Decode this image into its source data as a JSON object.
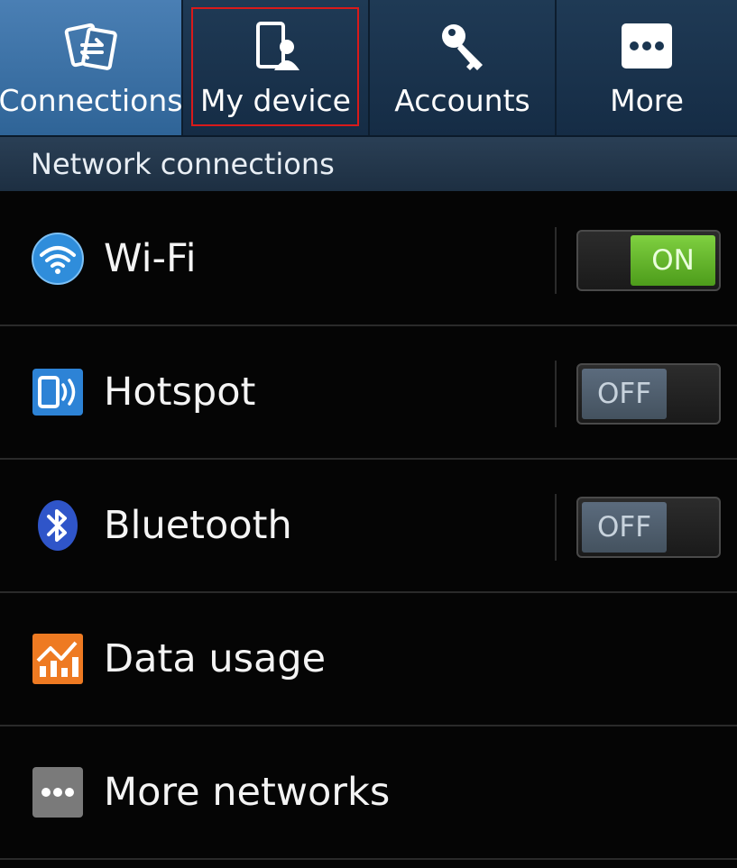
{
  "tabs": [
    {
      "label": "Connections",
      "icon": "connections-icon",
      "selected": true
    },
    {
      "label": "My device",
      "icon": "my-device-icon",
      "selected": false
    },
    {
      "label": "Accounts",
      "icon": "accounts-key-icon",
      "selected": false
    },
    {
      "label": "More",
      "icon": "more-dots-icon",
      "selected": false
    }
  ],
  "section_title": "Network connections",
  "items": [
    {
      "label": "Wi-Fi",
      "icon": "wifi-icon",
      "toggle": "ON"
    },
    {
      "label": "Hotspot",
      "icon": "hotspot-icon",
      "toggle": "OFF"
    },
    {
      "label": "Bluetooth",
      "icon": "bluetooth-icon",
      "toggle": "OFF"
    },
    {
      "label": "Data usage",
      "icon": "data-usage-icon"
    },
    {
      "label": "More networks",
      "icon": "more-networks-icon"
    }
  ],
  "colors": {
    "highlight_box": "#d91a1a",
    "toggle_on": "#6cc232",
    "toggle_off": "#4f5e6e",
    "selected_tab": "#3d73a8"
  }
}
